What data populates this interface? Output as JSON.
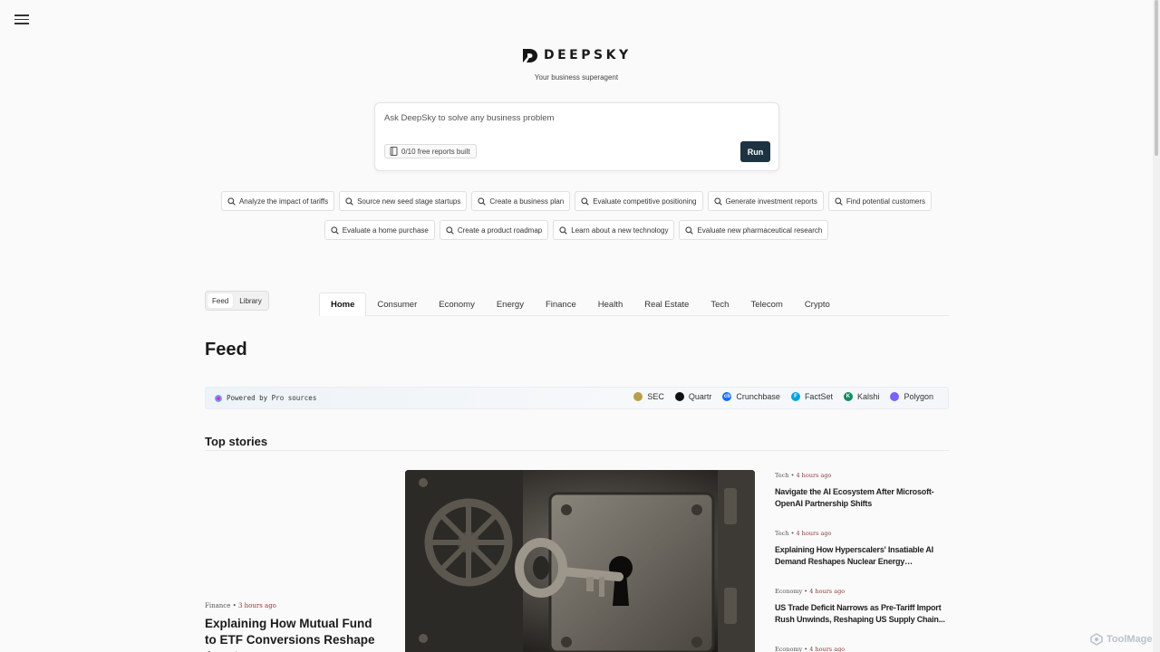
{
  "brand": {
    "name": "DEEPSKY",
    "tagline": "Your business superagent"
  },
  "ask": {
    "placeholder": "Ask DeepSky to solve any business problem",
    "reports_badge": "0/10 free reports built",
    "run_label": "Run"
  },
  "suggestions": {
    "row1": [
      "Analyze the impact of tariffs",
      "Source new seed stage startups",
      "Create a business plan",
      "Evaluate competitive positioning",
      "Generate investment reports",
      "Find potential customers"
    ],
    "row2": [
      "Evaluate a home purchase",
      "Create a product roadmap",
      "Learn about a new technology",
      "Evaluate new pharmaceutical research"
    ]
  },
  "view_toggle": {
    "feed": "Feed",
    "library": "Library",
    "active": "Feed"
  },
  "tabs": [
    "Home",
    "Consumer",
    "Economy",
    "Energy",
    "Finance",
    "Health",
    "Real Estate",
    "Tech",
    "Telecom",
    "Crypto"
  ],
  "active_tab": "Home",
  "feed": {
    "title": "Feed",
    "powered_by": "Powered by Pro sources",
    "sources": [
      {
        "name": "SEC",
        "icon": "sec-seal-icon",
        "color": "#b8a04a"
      },
      {
        "name": "Quartr",
        "icon": "quartr-icon",
        "color": "#111111"
      },
      {
        "name": "Crunchbase",
        "icon": "crunchbase-icon",
        "color": "#146aff"
      },
      {
        "name": "FactSet",
        "icon": "factset-icon",
        "color": "#00a3e0"
      },
      {
        "name": "Kalshi",
        "icon": "kalshi-icon",
        "color": "#0e8a5f"
      },
      {
        "name": "Polygon",
        "icon": "polygon-icon",
        "color": "#7b61ff"
      }
    ],
    "section_title": "Top stories",
    "main_story": {
      "category": "Finance",
      "time": "3 hours ago",
      "headline": "Explaining How Mutual Fund to ETF Conversions Reshape Asset"
    },
    "side_stories": [
      {
        "category": "Tech",
        "time": "4 hours ago",
        "headline": "Navigate the AI Ecosystem After Microsoft-OpenAI Partnership Shifts"
      },
      {
        "category": "Tech",
        "time": "4 hours ago",
        "headline": "Explaining How Hyperscalers' Insatiable AI Demand Reshapes Nuclear Energy Investment..."
      },
      {
        "category": "Economy",
        "time": "4 hours ago",
        "headline": "US Trade Deficit Narrows as Pre-Tariff Import Rush Unwinds, Reshaping US Supply Chain..."
      },
      {
        "category": "Economy",
        "time": "4 hours ago",
        "headline": ""
      }
    ]
  },
  "watermark": "ToolMage",
  "colors": {
    "accent": "#1d3341",
    "time": "#8a3b3b"
  }
}
